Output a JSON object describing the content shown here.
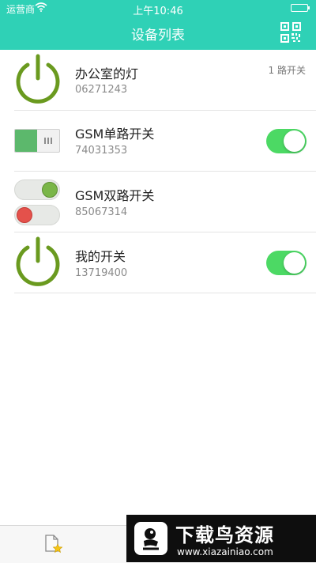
{
  "status_bar": {
    "carrier": "运营商",
    "time": "上午10:46"
  },
  "header": {
    "title": "设备列表",
    "qr_icon": "qr-code-icon"
  },
  "devices": [
    {
      "name": "办公室的灯",
      "code": "06271243",
      "meta": "1 路开关",
      "icon": "power-icon",
      "icon_color": "#6a9a1f"
    },
    {
      "name": "GSM单路开关",
      "code": "74031353",
      "icon": "rocker-switch-icon",
      "toggle_on": true
    },
    {
      "name": "GSM双路开关",
      "code": "85067314",
      "icon": "dual-switch-icon"
    },
    {
      "name": "我的开关",
      "code": "13719400",
      "icon": "power-icon",
      "icon_color": "#6a9a1f",
      "toggle_on": true
    }
  ],
  "tabbar": {
    "tab_icon": "favorite-document-icon"
  },
  "watermark": {
    "big": "下载鸟资源",
    "small": "www.xiazainiao.com"
  },
  "colors": {
    "accent": "#2fd1b6",
    "toggle_on": "#4cd964",
    "power": "#6a9a1f",
    "red_dot": "#e4514b",
    "green_dot": "#7ab648"
  }
}
